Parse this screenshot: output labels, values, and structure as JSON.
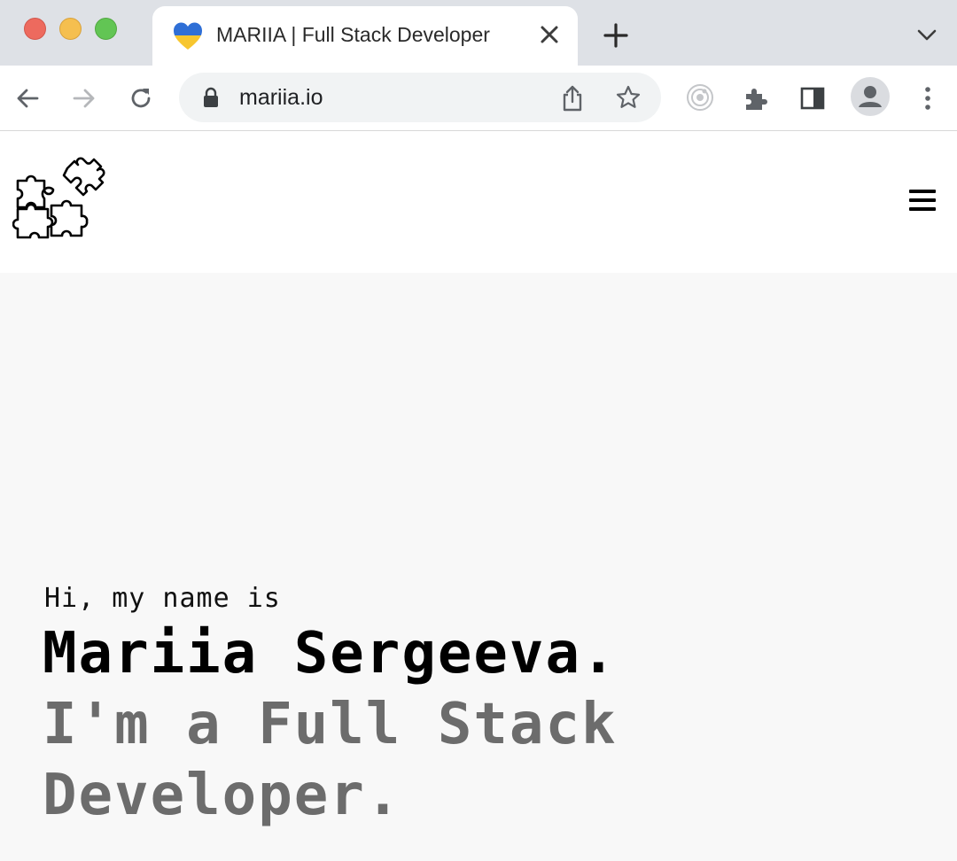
{
  "browser": {
    "tab": {
      "title": "MARIIA | Full Stack Developer",
      "favicon": "yellow-blue-heart-icon"
    },
    "address_bar": {
      "url": "mariia.io"
    },
    "colors": {
      "tabstrip": "#dee1e6",
      "traffic_close": "#ed6a5e",
      "traffic_minimize": "#f5bf4f",
      "traffic_maximize": "#62c554"
    }
  },
  "site": {
    "logo": "puzzle-pieces-icon",
    "menu_icon": "hamburger-menu-icon",
    "hero": {
      "greeting": "Hi, my name is",
      "name": "Mariia Sergeeva.",
      "role": "I'm a Full Stack Developer."
    },
    "colors": {
      "background": "#f8f8f8",
      "name": "#000000",
      "role": "#6c6c6c"
    }
  }
}
